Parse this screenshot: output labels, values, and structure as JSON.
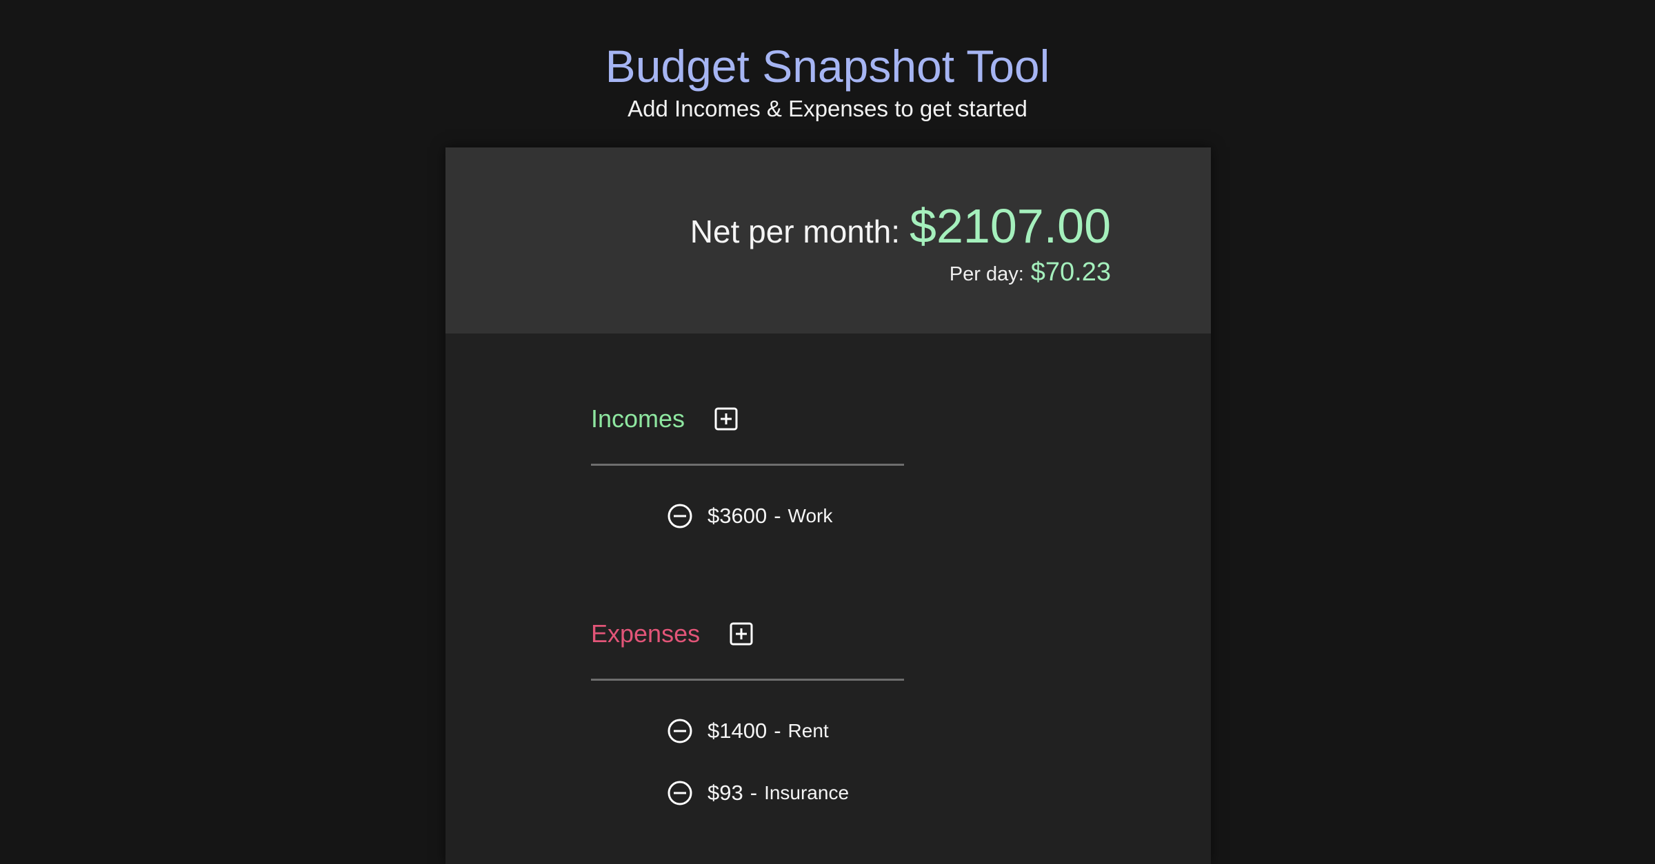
{
  "header": {
    "title": "Budget Snapshot Tool",
    "subtitle": "Add Incomes & Expenses to get started"
  },
  "summary": {
    "net_label": "Net per month:",
    "net_value": "$2107.00",
    "day_label": "Per day:",
    "day_value": "$70.23"
  },
  "incomes": {
    "title": "Incomes",
    "add_icon": "plus-square-icon",
    "items": [
      {
        "amount": "$3600",
        "separator": "-",
        "name": "Work",
        "remove_icon": "minus-circle-icon"
      }
    ]
  },
  "expenses": {
    "title": "Expenses",
    "add_icon": "plus-square-icon",
    "items": [
      {
        "amount": "$1400",
        "separator": "-",
        "name": "Rent",
        "remove_icon": "minus-circle-icon"
      },
      {
        "amount": "$93",
        "separator": "-",
        "name": "Insurance",
        "remove_icon": "minus-circle-icon"
      }
    ]
  },
  "colors": {
    "background": "#151515",
    "card": "#212121",
    "summary_panel": "#333333",
    "title": "#a6b5f3",
    "money": "#a5f0bd",
    "incomes": "#8ee6a0",
    "expenses": "#e25578"
  }
}
